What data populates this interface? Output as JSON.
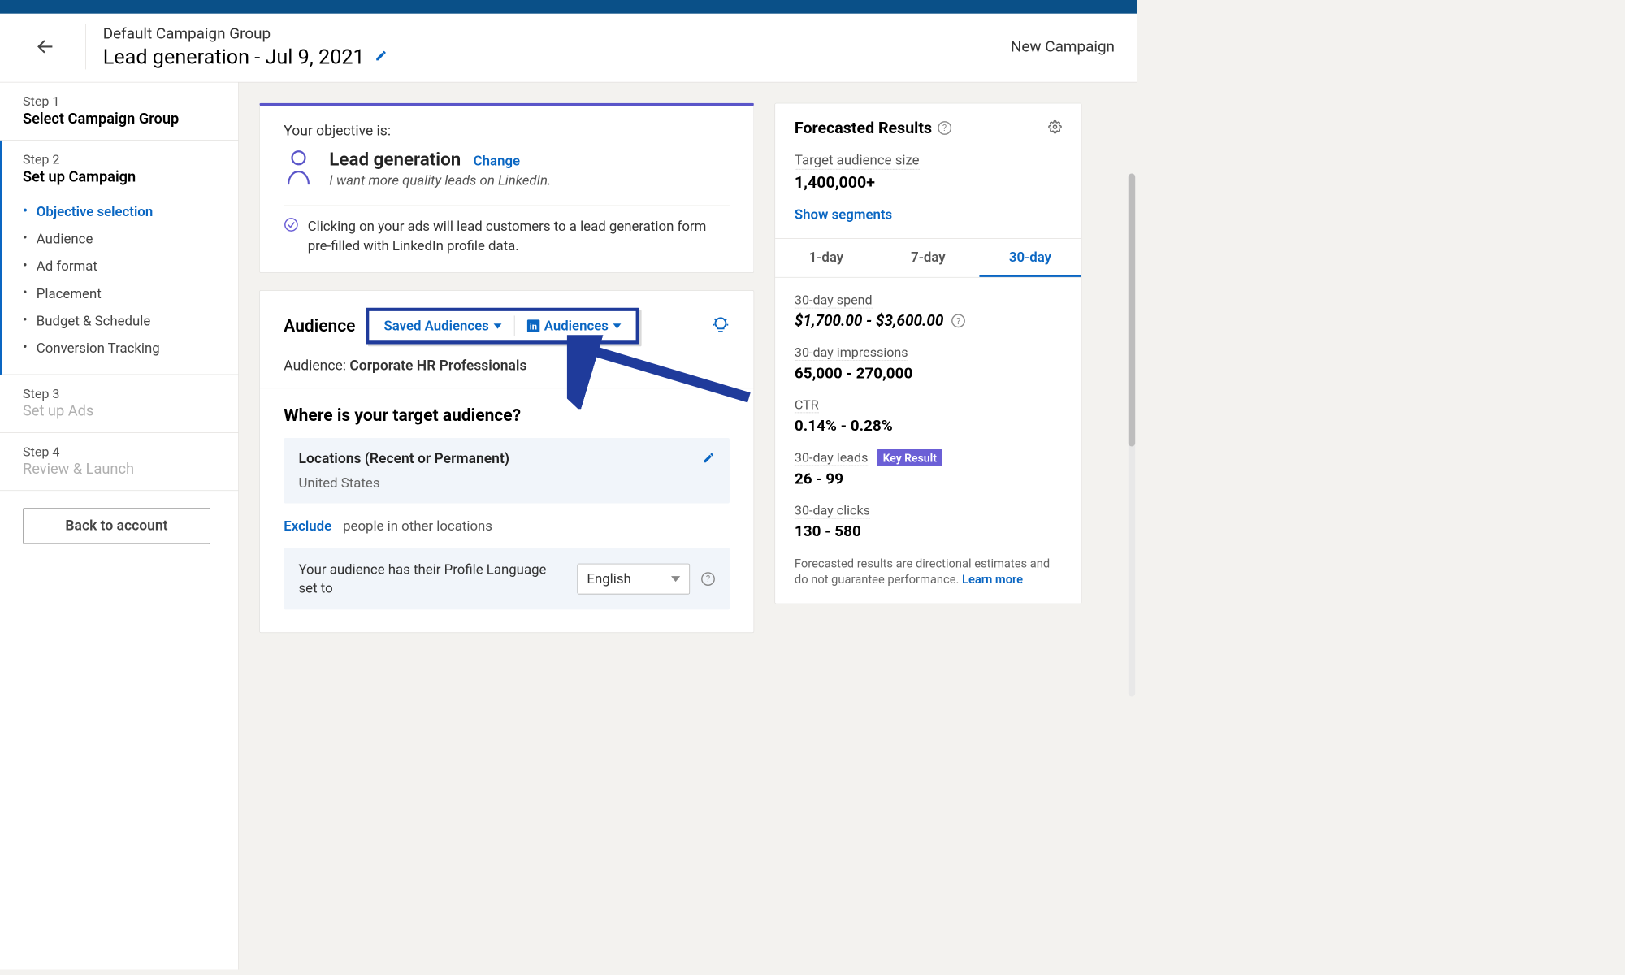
{
  "header": {
    "group_label": "Default Campaign Group",
    "campaign_title": "Lead generation - Jul 9, 2021",
    "new_campaign": "New Campaign"
  },
  "sidebar": {
    "steps": [
      {
        "label": "Step 1",
        "title": "Select Campaign Group"
      },
      {
        "label": "Step 2",
        "title": "Set up Campaign"
      },
      {
        "label": "Step 3",
        "title": "Set up Ads"
      },
      {
        "label": "Step 4",
        "title": "Review & Launch"
      }
    ],
    "substeps": [
      "Objective selection",
      "Audience",
      "Ad format",
      "Placement",
      "Budget & Schedule",
      "Conversion Tracking"
    ],
    "back_button": "Back to account"
  },
  "objective": {
    "intro": "Your objective is:",
    "title": "Lead generation",
    "change": "Change",
    "subtitle": "I want more quality leads on LinkedIn.",
    "note": "Clicking on your ads will lead customers to a lead generation form pre-filled with LinkedIn profile data."
  },
  "audience": {
    "heading": "Audience",
    "saved": "Saved Audiences",
    "aud_btn": "Audiences",
    "current_label": "Audience:",
    "current_name": "Corporate HR Professionals",
    "where_heading": "Where is your target audience?",
    "locations_label": "Locations (Recent or Permanent)",
    "locations_value": "United States",
    "exclude": "Exclude",
    "exclude_txt": "people in other locations",
    "lang_text": "Your audience has their Profile Language set to",
    "lang_value": "English"
  },
  "forecast": {
    "title": "Forecasted Results",
    "target_label": "Target audience size",
    "target_value": "1,400,000+",
    "show_segments": "Show segments",
    "tabs": [
      "1-day",
      "7-day",
      "30-day"
    ],
    "active_tab": 2,
    "metrics": [
      {
        "label": "30-day spend",
        "value": "$1,700.00 - $3,600.00",
        "help": true,
        "italic": true
      },
      {
        "label": "30-day impressions",
        "value": "65,000 - 270,000"
      },
      {
        "label": "CTR",
        "value": "0.14% - 0.28%"
      },
      {
        "label": "30-day leads",
        "value": "26 - 99",
        "badge": "Key Result"
      },
      {
        "label": "30-day clicks",
        "value": "130 - 580"
      }
    ],
    "disclaimer": "Forecasted results are directional estimates and do not guarantee performance.",
    "learn_more": "Learn more"
  }
}
